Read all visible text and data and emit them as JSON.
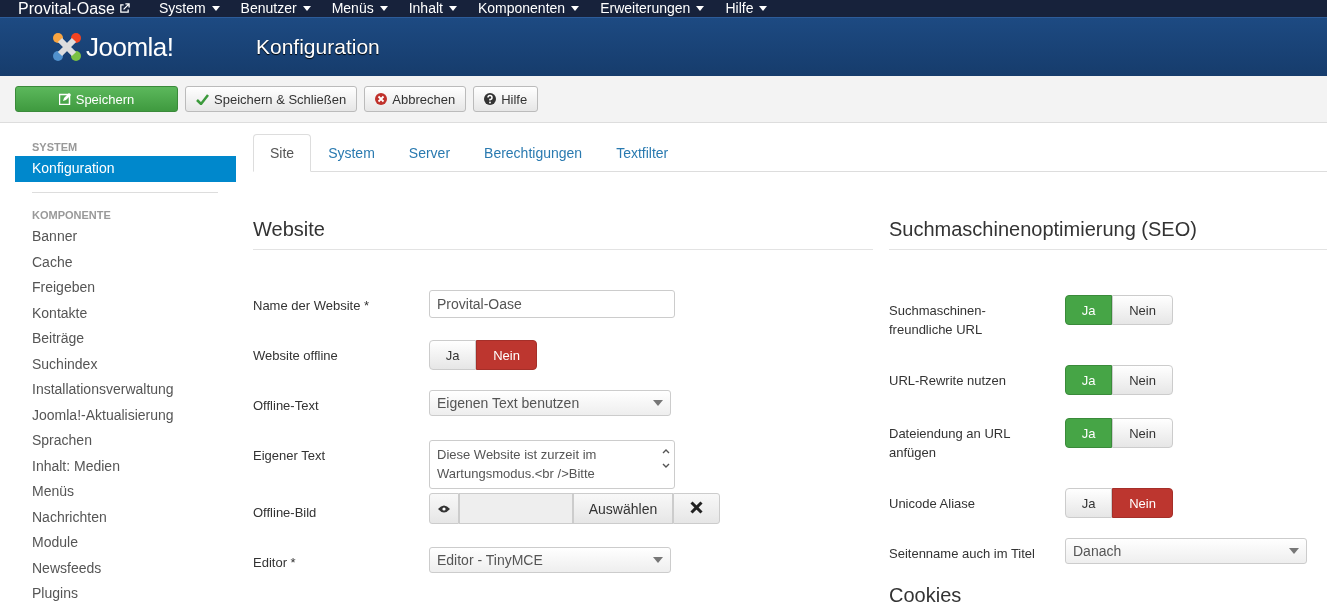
{
  "topbar": {
    "site_name": "Provital-Oase",
    "menus": [
      "System",
      "Benutzer",
      "Menüs",
      "Inhalt",
      "Komponenten",
      "Erweiterungen",
      "Hilfe"
    ]
  },
  "header": {
    "logo_text": "Joomla!",
    "title": "Konfiguration"
  },
  "toolbar": [
    {
      "label": "Speichern",
      "kind": "save"
    },
    {
      "label": "Speichern & Schließen",
      "kind": "check"
    },
    {
      "label": "Abbrechen",
      "kind": "cancel"
    },
    {
      "label": "Hilfe",
      "kind": "help"
    }
  ],
  "sidebar": [
    {
      "heading": "SYSTEM",
      "items": [
        {
          "label": "Konfiguration",
          "selected": true
        }
      ]
    },
    {
      "heading": "KOMPONENTE",
      "items": [
        {
          "label": "Banner",
          "selected": false
        },
        {
          "label": "Cache",
          "selected": false
        },
        {
          "label": "Freigeben",
          "selected": false
        },
        {
          "label": "Kontakte",
          "selected": false
        },
        {
          "label": "Beiträge",
          "selected": false
        },
        {
          "label": "Suchindex",
          "selected": false
        },
        {
          "label": "Installationsverwaltung",
          "selected": false
        },
        {
          "label": "Joomla!-Aktualisierung",
          "selected": false
        },
        {
          "label": "Sprachen",
          "selected": false
        },
        {
          "label": "Inhalt: Medien",
          "selected": false
        },
        {
          "label": "Menüs",
          "selected": false
        },
        {
          "label": "Nachrichten",
          "selected": false
        },
        {
          "label": "Module",
          "selected": false
        },
        {
          "label": "Newsfeeds",
          "selected": false
        },
        {
          "label": "Plugins",
          "selected": false
        }
      ]
    }
  ],
  "tabs": [
    {
      "label": "Site",
      "selected": true
    },
    {
      "label": "System",
      "selected": false
    },
    {
      "label": "Server",
      "selected": false
    },
    {
      "label": "Berechtigungen",
      "selected": false
    },
    {
      "label": "Textfilter",
      "selected": false
    }
  ],
  "left_section": {
    "title": "Website",
    "rows": [
      {
        "label": "Name der Website *",
        "kind": "text",
        "value": "Provital-Oase"
      },
      {
        "label": "Website offline",
        "kind": "toggle",
        "options": [
          {
            "label": "Ja",
            "kind": "yes",
            "selected": false
          },
          {
            "label": "Nein",
            "kind": "no",
            "selected": true
          }
        ]
      },
      {
        "label": "Offline-Text",
        "kind": "select",
        "value": "Eigenen Text benutzen"
      },
      {
        "label": "Eigener Text",
        "kind": "textarea",
        "value": "Diese Website ist zurzeit im Wartungsmodus.<br />Bitte"
      },
      {
        "label": "Offline-Bild",
        "kind": "media",
        "button": "Auswählen"
      },
      {
        "label": "Editor *",
        "kind": "select",
        "value": "Editor - TinyMCE"
      }
    ]
  },
  "right_section": {
    "title": "Suchmaschinenoptimierung (SEO)",
    "rows": [
      {
        "label": "Suchmaschinen-freundliche URL",
        "kind": "toggle",
        "options": [
          {
            "label": "Ja",
            "kind": "yes",
            "selected": true
          },
          {
            "label": "Nein",
            "kind": "no",
            "selected": false
          }
        ]
      },
      {
        "label": "URL-Rewrite nutzen",
        "kind": "toggle",
        "options": [
          {
            "label": "Ja",
            "kind": "yes",
            "selected": true
          },
          {
            "label": "Nein",
            "kind": "no",
            "selected": false
          }
        ]
      },
      {
        "label": "Dateiendung an URL anfügen",
        "kind": "toggle",
        "options": [
          {
            "label": "Ja",
            "kind": "yes",
            "selected": true
          },
          {
            "label": "Nein",
            "kind": "no",
            "selected": false
          }
        ]
      },
      {
        "label": "Unicode Aliase",
        "kind": "toggle",
        "options": [
          {
            "label": "Ja",
            "kind": "yes",
            "selected": false
          },
          {
            "label": "Nein",
            "kind": "no",
            "selected": true
          }
        ]
      },
      {
        "label": "Seitenname auch im Titel",
        "kind": "select",
        "value": "Danach"
      }
    ],
    "next_title": "Cookies"
  }
}
